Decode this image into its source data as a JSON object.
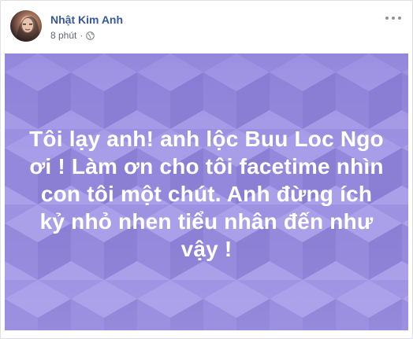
{
  "post": {
    "author_name": "Nhật Kim Anh",
    "timestamp": "8 phút",
    "separator": "·",
    "privacy_icon": "globe-icon",
    "more_icon": "more-options-icon",
    "text": "Tôi lạy anh! anh lộc Buu Loc Ngo ơi ! Làm ơn cho tôi facetime nhìn con tôi một chút. Anh đừng ích kỷ nhỏ nhen tiểu nhân đến như vậy !",
    "background_color": "#9b8fe0",
    "text_color": "#ffffff"
  }
}
